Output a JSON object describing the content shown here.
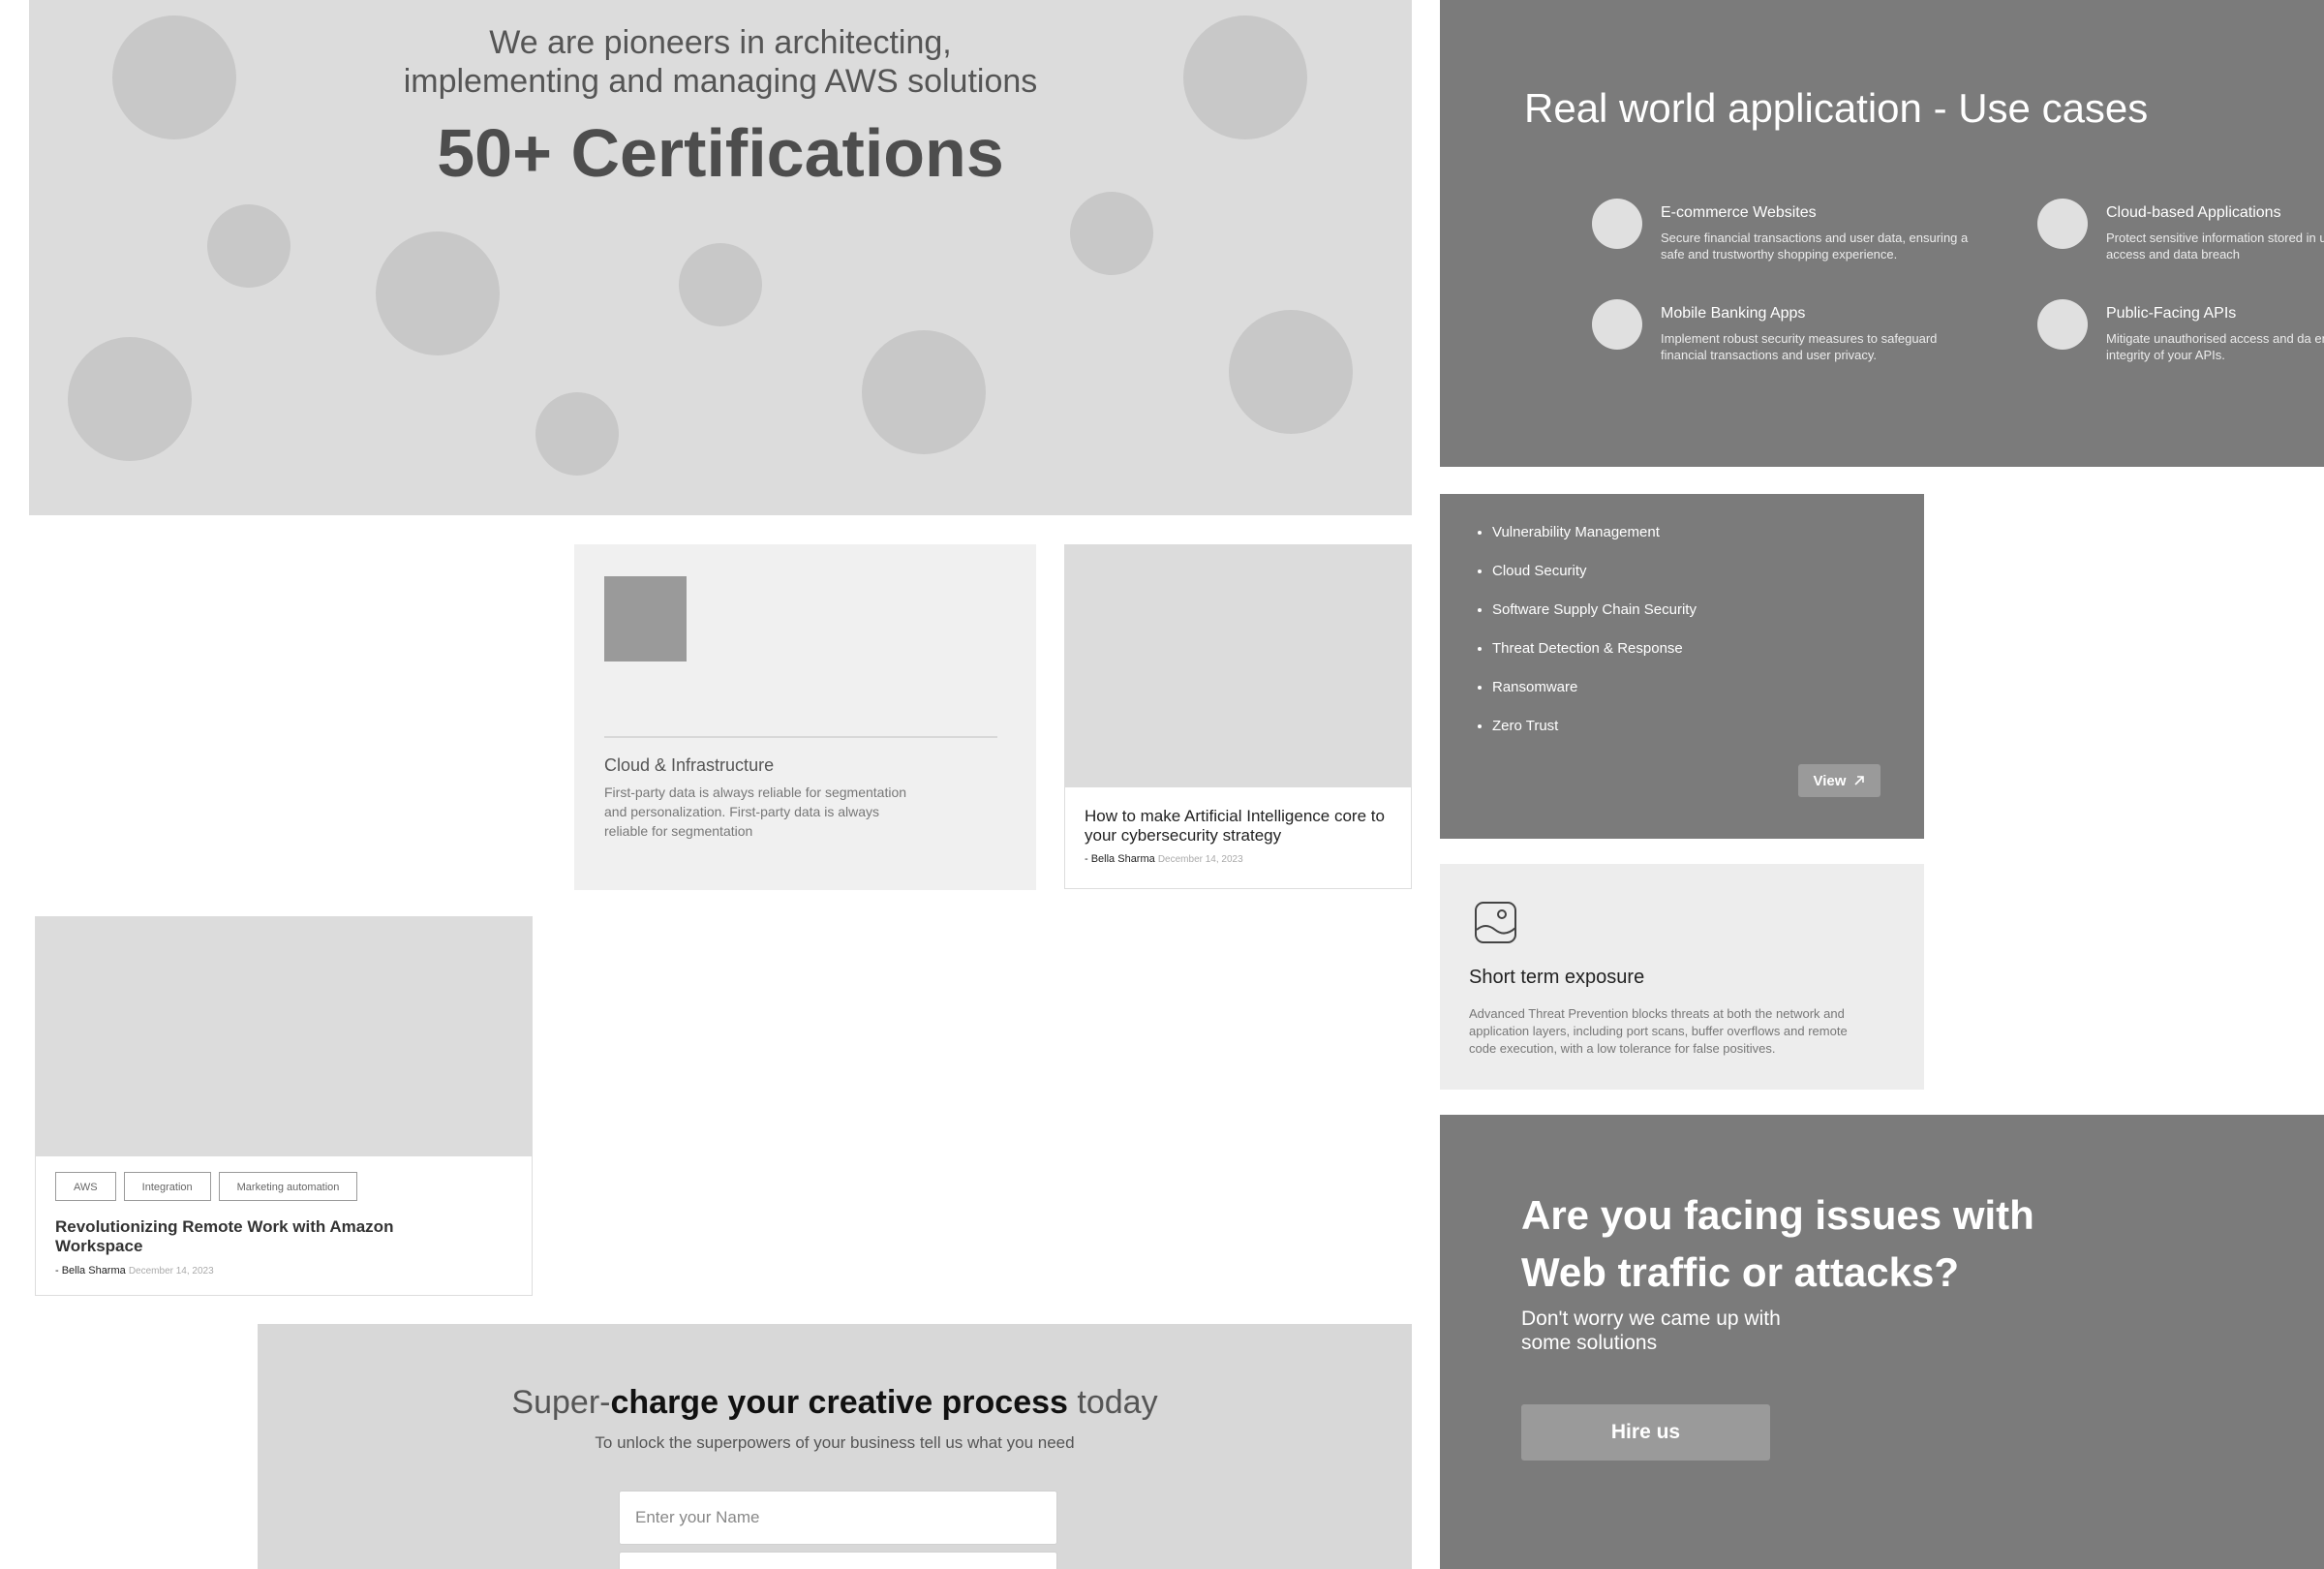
{
  "hero": {
    "tagline_line1": "We are pioneers in architecting,",
    "tagline_line2": "implementing and managing AWS solutions",
    "headline": "50+ Certifications"
  },
  "use_cases": {
    "title": "Real world application - Use cases",
    "items": [
      {
        "title": "E-commerce Websites",
        "desc": "Secure financial transactions and user data, ensuring a safe and trustworthy shopping experience."
      },
      {
        "title": "Cloud-based Applications",
        "desc": "Protect sensitive information stored in unauthorized access and data breach"
      },
      {
        "title": "Mobile Banking Apps",
        "desc": "Implement robust security measures to safeguard financial transactions and user privacy."
      },
      {
        "title": "Public-Facing APIs",
        "desc": "Mitigate unauthorised access and da ensuring the integrity of your APIs."
      }
    ]
  },
  "cloud_card": {
    "title": "Cloud & Infrastructure",
    "desc": "First-party data is always reliable for segmentation and personalization. First-party data is always reliable for segmentation"
  },
  "blog_ai": {
    "title": "How to make Artificial Intelligence core to your cybersecurity strategy",
    "author": "- Bella Sharma",
    "date": "December 14, 2023"
  },
  "blog_remote": {
    "tags": [
      "AWS",
      "Integration",
      "Marketing automation"
    ],
    "title": "Revolutionizing Remote Work with Amazon Workspace",
    "author": "- Bella Sharma",
    "date": "December 14, 2023"
  },
  "topics": {
    "items": [
      "Vulnerability Management",
      "Cloud Security",
      "Software Supply Chain Security",
      "Threat Detection & Response",
      "Ransomware",
      "Zero Trust"
    ],
    "view_label": "View",
    "view_icon": "arrow-up-right-icon"
  },
  "exposure": {
    "icon": "image-placeholder-icon",
    "title": "Short term exposure",
    "desc": "Advanced Threat Prevention blocks threats at both the network and application layers, including port scans, buffer overflows and remote code execution, with a low tolerance for false positives."
  },
  "traffic": {
    "title": "Are you facing issues with Web traffic or attacks?",
    "subtitle": "Don't worry we came up with some solutions",
    "hire_label": "Hire us"
  },
  "supercharge": {
    "title_prefix": "Super-",
    "title_bold": "charge your creative process",
    "title_suffix": " today",
    "subtitle": "To unlock the superpowers of your business tell us what you need",
    "name_placeholder": "Enter your Name"
  },
  "colors": {
    "dark_panel": "#7b7b7b",
    "light_panel": "#dcdcdc",
    "button": "#9a9a9a"
  }
}
